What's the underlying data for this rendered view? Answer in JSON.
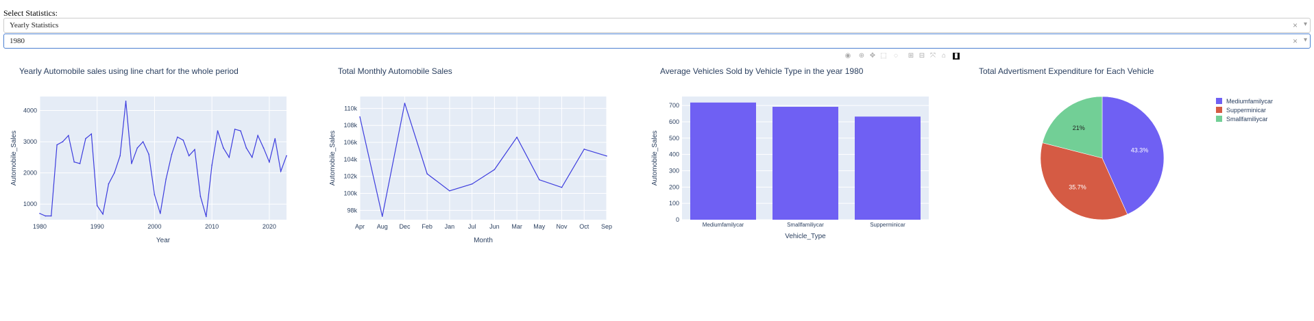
{
  "controls": {
    "select_label": "Select Statistics:",
    "statistics_value": "Yearly Statistics",
    "year_value": "1980",
    "clear_symbol": "×",
    "arrow_symbol": "▾"
  },
  "colors": {
    "line": "#3c3cde",
    "bar": "#6f60f3",
    "plot_bg": "#e5ecf6",
    "pie": [
      "#6f60f3",
      "#d55b44",
      "#72cf96"
    ]
  },
  "modebar_icons": [
    "camera-icon",
    "zoom-icon",
    "pan-icon",
    "box-select-icon",
    "lasso-icon",
    "zoom-in-icon",
    "zoom-out-icon",
    "autoscale-icon",
    "reset-axes-icon",
    "plotly-logo-icon"
  ],
  "chart_data": [
    {
      "type": "line",
      "title": "Yearly Automobile sales using line chart for the whole period",
      "xlabel": "Year",
      "ylabel": "Automobile_Sales",
      "xlim": [
        1980,
        2023
      ],
      "ylim": [
        500,
        4450
      ],
      "xticks": [
        1980,
        1990,
        2000,
        2010,
        2020
      ],
      "yticks": [
        1000,
        2000,
        3000,
        4000
      ],
      "x": [
        1980,
        1981,
        1982,
        1983,
        1984,
        1985,
        1986,
        1987,
        1988,
        1989,
        1990,
        1991,
        1992,
        1993,
        1994,
        1995,
        1996,
        1997,
        1998,
        1999,
        2000,
        2001,
        2002,
        2003,
        2004,
        2005,
        2006,
        2007,
        2008,
        2009,
        2010,
        2011,
        2012,
        2013,
        2014,
        2015,
        2016,
        2017,
        2018,
        2019,
        2020,
        2021,
        2022,
        2023
      ],
      "y": [
        700,
        620,
        620,
        2900,
        3000,
        3200,
        2350,
        2300,
        3100,
        3250,
        950,
        680,
        1650,
        2000,
        2550,
        4300,
        2300,
        2800,
        3000,
        2600,
        1300,
        700,
        1800,
        2600,
        3150,
        3050,
        2550,
        2750,
        1250,
        600,
        2250,
        3350,
        2800,
        2500,
        3400,
        3350,
        2800,
        2500,
        3200,
        2800,
        2350,
        3100,
        2050,
        2550
      ]
    },
    {
      "type": "line",
      "title": "Total Monthly Automobile Sales",
      "xlabel": "Month",
      "ylabel": "Automobile_Sales",
      "ylim": [
        96900,
        111400
      ],
      "categories": [
        "Apr",
        "Aug",
        "Dec",
        "Feb",
        "Jan",
        "Jul",
        "Jun",
        "Mar",
        "May",
        "Nov",
        "Oct",
        "Sep"
      ],
      "ytick_values": [
        98000,
        100000,
        102000,
        104000,
        106000,
        108000,
        110000
      ],
      "ytick_labels": [
        "98k",
        "100k",
        "102k",
        "104k",
        "106k",
        "108k",
        "110k"
      ],
      "values": [
        109000,
        97300,
        110600,
        102300,
        100300,
        101100,
        102800,
        106600,
        101600,
        100700,
        105200,
        104400
      ]
    },
    {
      "type": "bar",
      "title": "Average Vehicles Sold by Vehicle Type in the year 1980",
      "xlabel": "Vehicle_Type",
      "ylabel": "Automobile_Sales",
      "ylim": [
        0,
        755
      ],
      "yticks": [
        0,
        100,
        200,
        300,
        400,
        500,
        600,
        700
      ],
      "categories": [
        "Mediumfamilycar",
        "Smallfamiliycar",
        "Supperminicar"
      ],
      "values": [
        718,
        692,
        632
      ]
    },
    {
      "type": "pie",
      "title": "Total Advertisment Expenditure for Each Vehicle",
      "labels": [
        "Mediumfamilycar",
        "Supperminicar",
        "Smallfamiliycar"
      ],
      "values": [
        43.3,
        35.7,
        21
      ],
      "text_labels": [
        "43.3%",
        "35.7%",
        "21%"
      ]
    }
  ]
}
